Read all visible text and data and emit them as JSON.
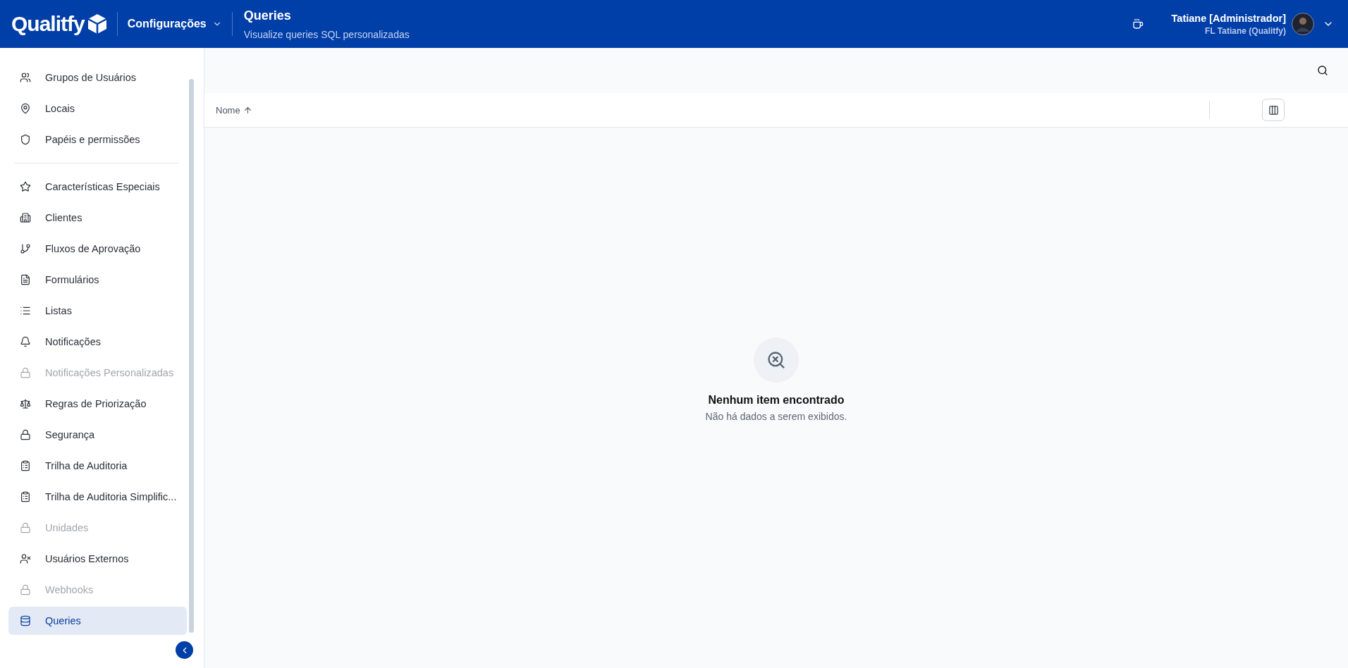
{
  "header": {
    "logo": "Qualitfy",
    "section": "Configurações",
    "title": "Queries",
    "subtitle": "Visualize queries SQL personalizadas",
    "user": {
      "name": "Tatiane [Administrador]",
      "organization": "FL Tatiane (Qualitfy)"
    }
  },
  "sidebar": {
    "sections": [
      {
        "items": [
          {
            "label": "Grupos de Usuários",
            "disabled": false,
            "selected": false
          },
          {
            "label": "Locais",
            "disabled": false,
            "selected": false
          },
          {
            "label": "Papéis e permissões",
            "disabled": false,
            "selected": false
          }
        ]
      },
      {
        "items": [
          {
            "label": "Características Especiais",
            "disabled": false,
            "selected": false
          },
          {
            "label": "Clientes",
            "disabled": false,
            "selected": false
          },
          {
            "label": "Fluxos de Aprovação",
            "disabled": false,
            "selected": false
          },
          {
            "label": "Formulários",
            "disabled": false,
            "selected": false
          },
          {
            "label": "Listas",
            "disabled": false,
            "selected": false
          },
          {
            "label": "Notificações",
            "disabled": false,
            "selected": false
          },
          {
            "label": "Notificações Personalizadas",
            "disabled": true,
            "selected": false
          },
          {
            "label": "Regras de Priorização",
            "disabled": false,
            "selected": false
          },
          {
            "label": "Segurança",
            "disabled": false,
            "selected": false
          },
          {
            "label": "Trilha de Auditoria",
            "disabled": false,
            "selected": false
          },
          {
            "label": "Trilha de Auditoria Simplific...",
            "disabled": false,
            "selected": false
          },
          {
            "label": "Unidades",
            "disabled": true,
            "selected": false
          },
          {
            "label": "Usuários Externos",
            "disabled": false,
            "selected": false
          },
          {
            "label": "Webhooks",
            "disabled": true,
            "selected": false
          },
          {
            "label": "Queries",
            "disabled": false,
            "selected": true
          }
        ]
      }
    ]
  },
  "table": {
    "columns": [
      {
        "label": "Nome",
        "sorted_ascending": true
      }
    ]
  },
  "empty_state": {
    "title": "Nenhum item encontrado",
    "message": "Não há dados a serem exibidos."
  }
}
